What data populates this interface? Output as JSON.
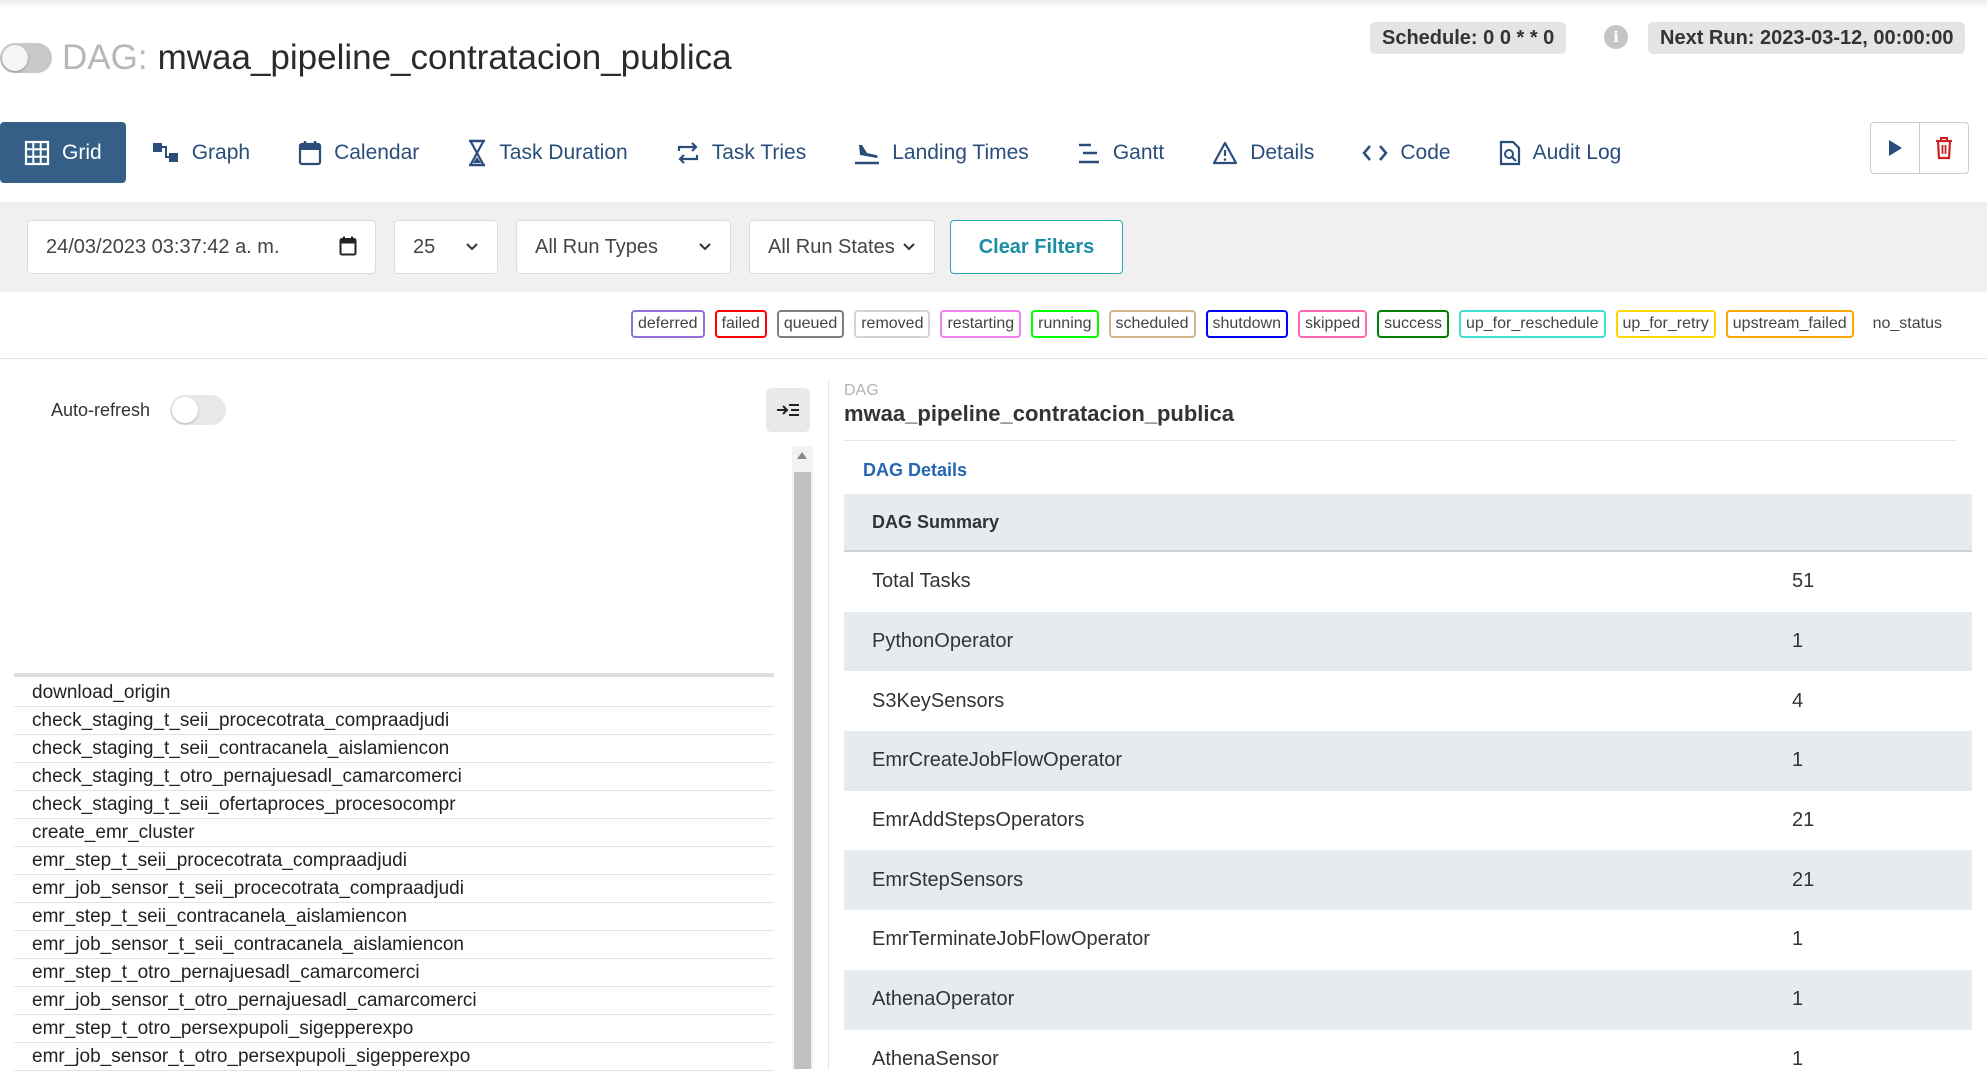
{
  "header": {
    "dag_prefix": "DAG:",
    "dag_name": "mwaa_pipeline_contratacion_publica",
    "schedule": "Schedule: 0 0 * * 0",
    "next_run": "Next Run: 2023-03-12, 00:00:00",
    "info_glyph": "i"
  },
  "nav": {
    "tabs": [
      {
        "label": "Grid",
        "icon": "grid-icon"
      },
      {
        "label": "Graph",
        "icon": "graph-icon"
      },
      {
        "label": "Calendar",
        "icon": "calendar-icon"
      },
      {
        "label": "Task Duration",
        "icon": "hourglass-icon"
      },
      {
        "label": "Task Tries",
        "icon": "retry-icon"
      },
      {
        "label": "Landing Times",
        "icon": "landing-icon"
      },
      {
        "label": "Gantt",
        "icon": "gantt-icon"
      },
      {
        "label": "Details",
        "icon": "warning-icon"
      },
      {
        "label": "Code",
        "icon": "code-icon"
      },
      {
        "label": "Audit Log",
        "icon": "audit-log-icon"
      }
    ],
    "active": "Grid"
  },
  "filters": {
    "datetime": "24/03/2023 03:37:42 a. m.",
    "num_runs": "25",
    "run_types": "All Run Types",
    "run_states": "All Run States",
    "clear_label": "Clear Filters"
  },
  "legend": [
    {
      "label": "deferred",
      "color": "#9370db"
    },
    {
      "label": "failed",
      "color": "#ff0000"
    },
    {
      "label": "queued",
      "color": "#808080"
    },
    {
      "label": "removed",
      "color": "#d3d3d3"
    },
    {
      "label": "restarting",
      "color": "#ee82ee"
    },
    {
      "label": "running",
      "color": "#00ff00"
    },
    {
      "label": "scheduled",
      "color": "#d2b48c"
    },
    {
      "label": "shutdown",
      "color": "#0000ff"
    },
    {
      "label": "skipped",
      "color": "#ff69b4"
    },
    {
      "label": "success",
      "color": "#008000"
    },
    {
      "label": "up_for_reschedule",
      "color": "#40e0d0"
    },
    {
      "label": "up_for_retry",
      "color": "#ffd700"
    },
    {
      "label": "upstream_failed",
      "color": "#ffa500"
    },
    {
      "label": "no_status",
      "color": ""
    }
  ],
  "left_panel": {
    "auto_refresh_label": "Auto-refresh",
    "tasks": [
      "download_origin",
      "check_staging_t_seii_procecotrata_compraadjudi",
      "check_staging_t_seii_contracanela_aislamiencon",
      "check_staging_t_otro_pernajuesadl_camarcomerci",
      "check_staging_t_seii_ofertaproces_procesocompr",
      "create_emr_cluster",
      "emr_step_t_seii_procecotrata_compraadjudi",
      "emr_job_sensor_t_seii_procecotrata_compraadjudi",
      "emr_step_t_seii_contracanela_aislamiencon",
      "emr_job_sensor_t_seii_contracanela_aislamiencon",
      "emr_step_t_otro_pernajuesadl_camarcomerci",
      "emr_job_sensor_t_otro_pernajuesadl_camarcomerci",
      "emr_step_t_otro_persexpupoli_sigepperexpo",
      "emr_job_sensor_t_otro_persexpupoli_sigepperexpo"
    ]
  },
  "right_panel": {
    "dag_label": "DAG",
    "dag_name": "mwaa_pipeline_contratacion_publica",
    "details_link": "DAG Details",
    "summary_title": "DAG Summary",
    "summary_rows": [
      {
        "label": "Total Tasks",
        "value": "51"
      },
      {
        "label": "PythonOperator",
        "value": "1"
      },
      {
        "label": "S3KeySensors",
        "value": "4"
      },
      {
        "label": "EmrCreateJobFlowOperator",
        "value": "1"
      },
      {
        "label": "EmrAddStepsOperators",
        "value": "21"
      },
      {
        "label": "EmrStepSensors",
        "value": "21"
      },
      {
        "label": "EmrTerminateJobFlowOperator",
        "value": "1"
      },
      {
        "label": "AthenaOperator",
        "value": "1"
      },
      {
        "label": "AthenaSensor",
        "value": "1"
      }
    ]
  },
  "colors": {
    "nav_active_bg": "#365f87",
    "nav_text": "#2a4d7a",
    "clear_button": "#1a8ea4",
    "link": "#2766b0",
    "trigger_icon": "#2a4d7a",
    "delete_icon": "#cc2222"
  }
}
